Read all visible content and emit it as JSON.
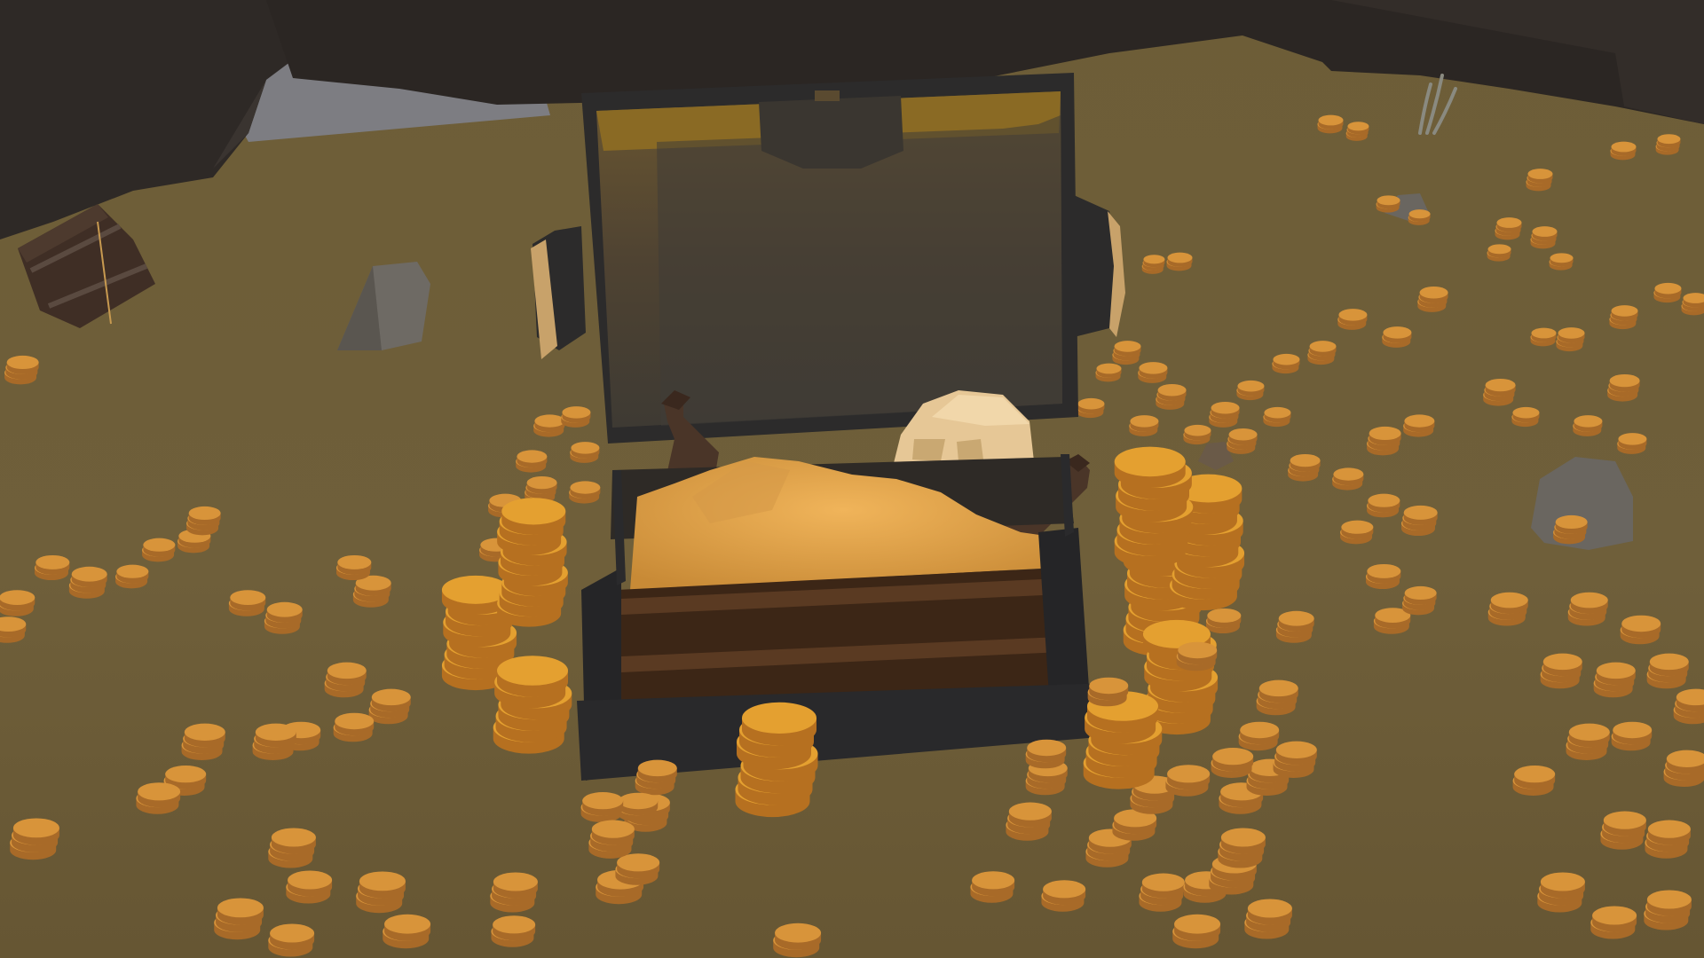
{
  "scene": {
    "type": "3d-low-poly-game-scene",
    "subject": "open-treasure-chest",
    "objects": [
      "cave-ceiling",
      "sand-floor",
      "treasure-chest",
      "skull",
      "sand-pile",
      "gold-coin-stacks",
      "wooden-barrel",
      "rocks",
      "seaweed",
      "bottles"
    ],
    "colors": {
      "sand": "#6e5e38",
      "sand_light": "#7a6940",
      "cave_rock": "#2b2623",
      "cave_rock_mid": "#3a3430",
      "chest_frame": "#2a2a2c",
      "chest_wood": "#4a2f1a",
      "chest_wood_dark": "#2e1c10",
      "chest_lid_inner": "#5a4a30",
      "chest_lid_glow": "#c99a2a",
      "treasure_sand": "#e6a64a",
      "gold_top": "#e4a030",
      "gold_side": "#b67020",
      "coin_top": "#d8943a",
      "coin_side": "#a86a28",
      "skull": "#e8c898",
      "rock": "#6a6660",
      "barrel": "#3f2e25"
    }
  }
}
